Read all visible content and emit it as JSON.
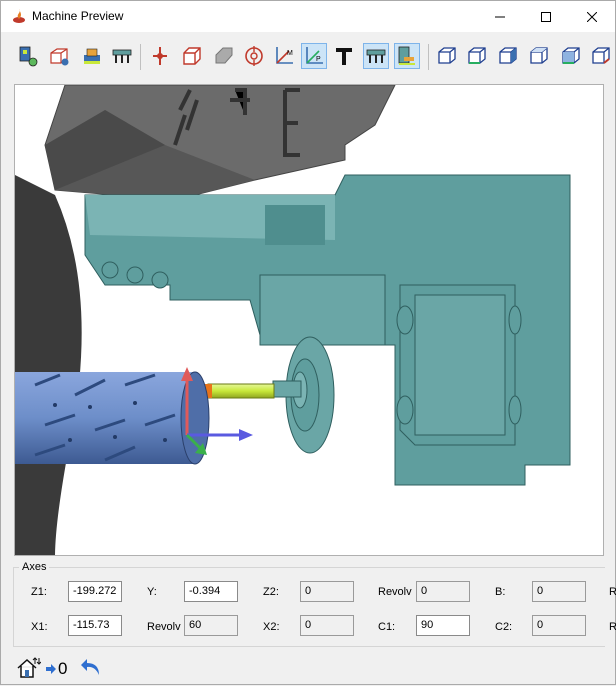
{
  "window": {
    "title": "Machine Preview"
  },
  "toolbar": {
    "buttons": [
      "machine-settings-icon",
      "workpiece-icon",
      "fixture-icon",
      "turret-icon",
      "tool-point-icon",
      "stock-icon",
      "part-icon",
      "target-icon",
      "machine-axes-icon",
      "program-axes-icon",
      "text-icon",
      "turret-view-icon",
      "holder-view-icon",
      "view-iso-icon",
      "view-front-icon",
      "view-side-icon",
      "view-top-icon",
      "view-right-icon",
      "view-back-icon"
    ],
    "active": [
      "program-axes-icon",
      "turret-view-icon",
      "holder-view-icon"
    ]
  },
  "viewport": {
    "colors": {
      "machine": "#5f9e9e",
      "head": "#6b6b6b",
      "stock": "#6d8ec9",
      "tool": "#c8e83a"
    }
  },
  "axes": {
    "legend": "Axes",
    "row1": [
      {
        "label": "Z1:",
        "value": "-199.272",
        "readonly": false
      },
      {
        "label": "Y:",
        "value": "-0.394",
        "readonly": false
      },
      {
        "label": "Z2:",
        "value": "0",
        "readonly": true
      },
      {
        "label": "Revolv",
        "value": "0",
        "readonly": true
      },
      {
        "label": "B:",
        "value": "0",
        "readonly": true
      },
      {
        "label": "R",
        "value": "",
        "readonly": true
      }
    ],
    "row2": [
      {
        "label": "X1:",
        "value": "-115.73",
        "readonly": false
      },
      {
        "label": "Revolv",
        "value": "60",
        "readonly": true
      },
      {
        "label": "X2:",
        "value": "0",
        "readonly": true
      },
      {
        "label": "C1:",
        "value": "90",
        "readonly": false
      },
      {
        "label": "C2:",
        "value": "0",
        "readonly": true
      },
      {
        "label": "R",
        "value": "",
        "readonly": true
      }
    ]
  },
  "status": {
    "counter": "0"
  }
}
